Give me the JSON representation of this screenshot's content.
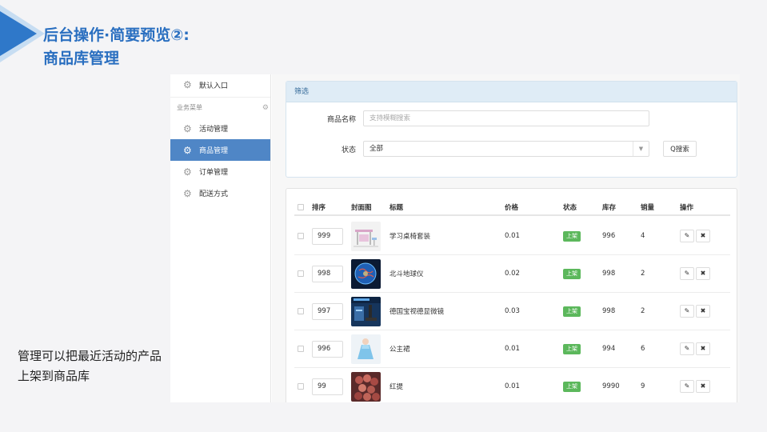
{
  "slide": {
    "title_line1": "后台操作·简要预览②:",
    "title_line2": "商品库管理",
    "note": "管理可以把最近活动的产品上架到商品库",
    "accent_color": "#2f78c9"
  },
  "sidebar": {
    "top_item": {
      "label": "默认入口",
      "icon": "gear-icon"
    },
    "section_label": "业务菜单",
    "items": [
      {
        "label": "活动管理",
        "icon": "gear-icon",
        "active": false
      },
      {
        "label": "商品管理",
        "icon": "gear-icon",
        "active": true
      },
      {
        "label": "订单管理",
        "icon": "gear-icon",
        "active": false
      },
      {
        "label": "配送方式",
        "icon": "gear-icon",
        "active": false
      }
    ]
  },
  "filter": {
    "title": "筛选",
    "name_label": "商品名称",
    "name_placeholder": "支持模糊搜索",
    "status_label": "状态",
    "status_value": "全部",
    "search_button": "Q搜索"
  },
  "table": {
    "headers": [
      "排序",
      "封面图",
      "标题",
      "价格",
      "状态",
      "库存",
      "销量",
      "操作"
    ],
    "rows": [
      {
        "sort": "999",
        "title": "学习桌椅套装",
        "price": "0.01",
        "status": "上架",
        "stock": "996",
        "sales": "4",
        "thumb": "desk-chair-thumb"
      },
      {
        "sort": "998",
        "title": "北斗地球仪",
        "price": "0.02",
        "status": "上架",
        "stock": "998",
        "sales": "2",
        "thumb": "globe-thumb"
      },
      {
        "sort": "997",
        "title": "德国宝视德显微镜",
        "price": "0.03",
        "status": "上架",
        "stock": "998",
        "sales": "2",
        "thumb": "microscope-thumb"
      },
      {
        "sort": "996",
        "title": "公主裙",
        "price": "0.01",
        "status": "上架",
        "stock": "994",
        "sales": "6",
        "thumb": "dress-thumb"
      },
      {
        "sort": "99",
        "title": "红提",
        "price": "0.01",
        "status": "上架",
        "stock": "9990",
        "sales": "9",
        "thumb": "grapes-thumb"
      }
    ],
    "edit_icon": "edit-icon",
    "delete_icon": "close-icon"
  }
}
